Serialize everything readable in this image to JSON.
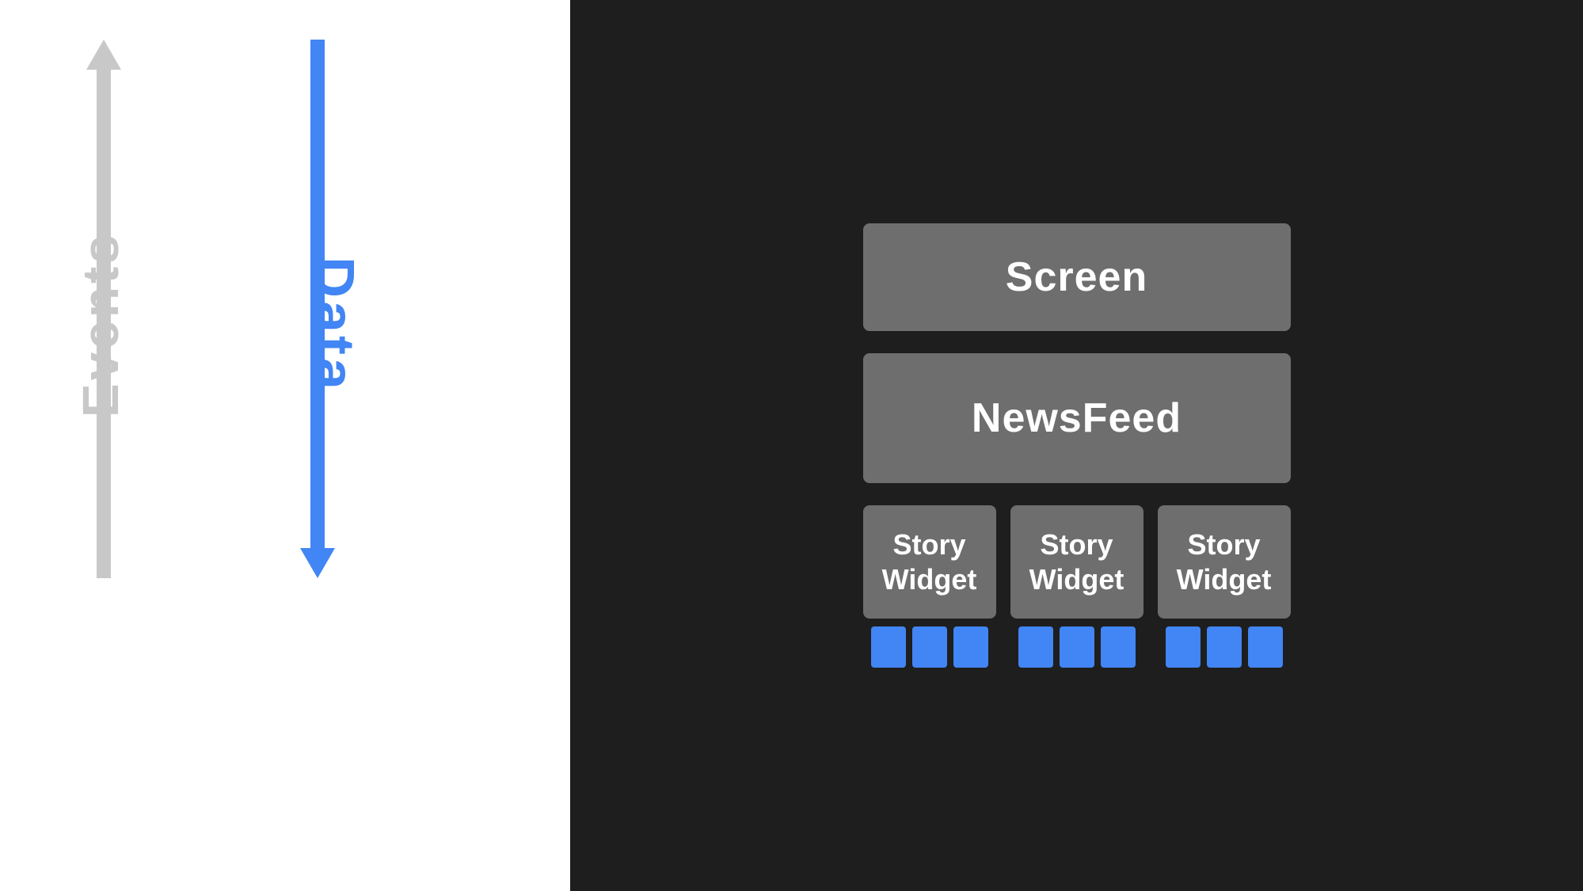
{
  "left": {
    "events_label": "Events",
    "data_label": "Data"
  },
  "right": {
    "screen_label": "Screen",
    "newsfeed_label": "NewsFeed",
    "story_widgets": [
      {
        "label": "Story Widget",
        "sub_items": 3
      },
      {
        "label": "Story Widget",
        "sub_items": 3
      },
      {
        "label": "Story Widget",
        "sub_items": 3
      }
    ]
  },
  "colors": {
    "blue": "#4285f4",
    "gray_box": "#6e6e6e",
    "dark_bg": "#1e1e1e",
    "white": "#ffffff",
    "light_gray": "#c8c8c8"
  }
}
